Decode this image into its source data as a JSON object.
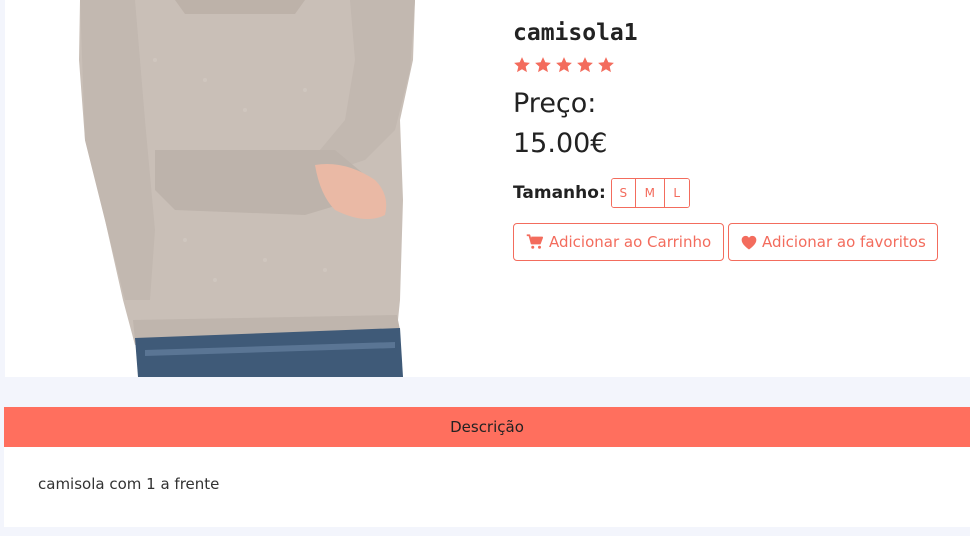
{
  "product": {
    "name": "camisola1",
    "rating_stars": 5,
    "price_label": "Preço:",
    "price": "15.00€",
    "size_label": "Tamanho:",
    "sizes": [
      "S",
      "M",
      "L"
    ],
    "add_to_cart_label": "Adicionar ao Carrinho",
    "add_to_favorites_label": "Adicionar ao favoritos",
    "image_icon": "product-photo-sweater"
  },
  "description": {
    "header": "Descrição",
    "text": "camisola com 1 a frente"
  },
  "colors": {
    "accent": "#f36c5d",
    "header_bg": "#ff6f5e",
    "page_bg": "#f3f5fc"
  }
}
